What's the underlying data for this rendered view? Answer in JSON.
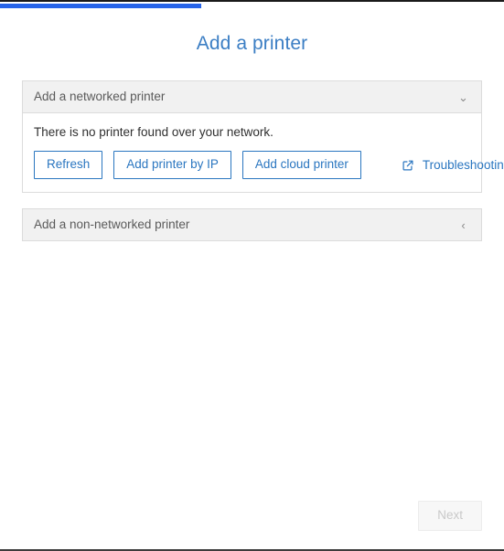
{
  "window": {
    "title": "Add a printer"
  },
  "progress": {
    "name": "setup-progress",
    "percent": 40,
    "fill_color": "#2764e8"
  },
  "header": {
    "title": "Add a printer",
    "title_color": "#3b7ec4"
  },
  "panels": [
    {
      "id": "networked",
      "title": "Add a networked printer",
      "expanded": true,
      "chevron_icon": "chevron-down-icon",
      "chevron_glyph": "⌄",
      "message": "There is no printer found over your network.",
      "buttons": [
        {
          "id": "refresh",
          "label": "Refresh"
        },
        {
          "id": "add-printer-by-ip",
          "label": "Add printer by IP"
        },
        {
          "id": "add-cloud-printer",
          "label": "Add cloud printer"
        }
      ],
      "link": {
        "id": "troubleshooting",
        "label": "Troubleshooting",
        "icon": "external-link-icon"
      }
    },
    {
      "id": "non-networked",
      "title": "Add a non-networked printer",
      "expanded": false,
      "chevron_icon": "chevron-left-icon",
      "chevron_glyph": "‹"
    }
  ],
  "footer": {
    "next_label": "Next",
    "next_disabled": true
  },
  "colors": {
    "accent_blue": "#2a76c0",
    "progress_blue": "#2764e8",
    "panel_header_bg": "#f1f1f1",
    "panel_border": "#dcdcdc",
    "disabled_text": "#c9c9c9"
  }
}
